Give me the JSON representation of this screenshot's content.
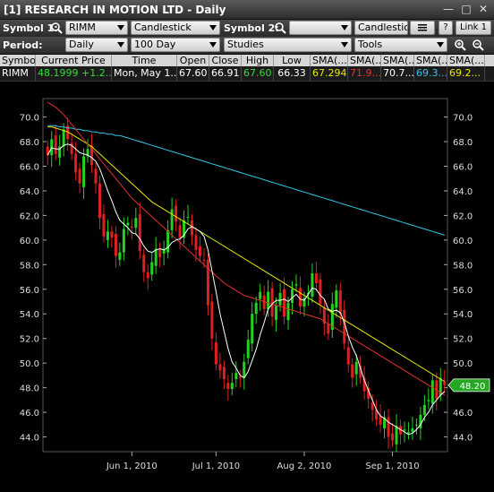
{
  "window": {
    "title": "[1] RESEARCH IN MOTION LTD - Daily"
  },
  "toolbar1": {
    "symbol1_label": "Symbol 1:",
    "symbol1_value": "RIMM",
    "chart_type": "Candlestick",
    "symbol2_label": "Symbol 2:",
    "symbol2_value": "",
    "chart_type2": "Candlestick",
    "help_label": "?",
    "link_label": "Link 1"
  },
  "toolbar2": {
    "period_label": "Period:",
    "period_value": "Daily",
    "range_value": "100 Day",
    "studies_value": "Studies",
    "tools_value": "Tools"
  },
  "quote": {
    "headers": [
      "Symbol",
      "Current Price",
      "Time",
      "Open",
      "Close",
      "High",
      "Low",
      "SMA(...",
      "SMA(...",
      "SMA(...",
      "SMA(...",
      "SMA(..."
    ],
    "values": [
      "RIMM",
      "48.1999 +1.2...",
      "Mon, May 1...",
      "67.60",
      "66.91",
      "67.60",
      "66.33",
      "67.294",
      "71.9...",
      "70.7...",
      "69.3...",
      "69.2..."
    ],
    "colors": [
      "#ffffff",
      "#33dd33",
      "#ffffff",
      "#ffffff",
      "#ffffff",
      "#33dd33",
      "#ffffff",
      "#e8e800",
      "#e23030",
      "#ffffff",
      "#33c8e6",
      "#e8e800"
    ]
  },
  "chart_data": {
    "type": "candlestick",
    "price_axis": {
      "min": 42.8,
      "max": 71.5,
      "ticks": [
        "70.0",
        "68.0",
        "66.0",
        "64.0",
        "62.0",
        "60.0",
        "58.0",
        "56.0",
        "54.0",
        "52.0",
        "50.0",
        "48.0",
        "46.0",
        "44.0"
      ]
    },
    "x_labels": [
      "Jun 1, 2010",
      "Jul 1, 2010",
      "Aug 2, 2010",
      "Sep 1, 2010"
    ],
    "current_price_tag": "48.20",
    "closes": [
      66.9,
      68.2,
      67.0,
      67.6,
      69.0,
      68.2,
      67.0,
      65.5,
      64.6,
      66.8,
      67.4,
      66.1,
      64.6,
      61.8,
      60.3,
      60.7,
      60.2,
      58.7,
      59.0,
      60.9,
      61.4,
      61.0,
      61.8,
      59.1,
      57.4,
      56.9,
      58.2,
      59.3,
      58.6,
      59.3,
      60.8,
      62.5,
      61.5,
      60.2,
      61.6,
      61.9,
      60.4,
      59.2,
      58.7,
      58.4,
      54.7,
      52.0,
      49.9,
      49.4,
      48.7,
      47.9,
      48.4,
      49.2,
      48.8,
      50.1,
      51.9,
      54.0,
      54.9,
      55.8,
      54.4,
      55.8,
      53.8,
      54.7,
      55.7,
      53.8,
      54.9,
      56.0,
      56.4,
      54.6,
      55.3,
      55.7,
      57.3,
      56.5,
      54.8,
      53.2,
      52.4,
      54.8,
      55.9,
      54.0,
      51.6,
      49.9,
      48.8,
      50.1,
      48.8,
      47.7,
      47.1,
      46.2,
      45.4,
      45.0,
      45.6,
      44.0,
      43.7,
      44.9,
      44.2,
      44.6,
      44.4,
      44.7,
      45.0,
      45.8,
      46.6,
      47.0,
      48.6,
      47.1,
      48.8,
      48.2
    ],
    "sma_short": {
      "color": "#ffffff",
      "values": [
        66.9,
        67.5,
        67.4,
        67.4,
        67.7,
        67.8,
        67.7,
        67.4,
        67.1,
        67.0,
        66.9,
        66.7,
        66.4,
        65.8,
        64.9,
        64.0,
        63.2,
        62.3,
        61.6,
        61.3,
        61.0,
        60.6,
        60.5,
        60.1,
        59.5,
        59.1,
        59.0,
        59.2,
        59.3,
        59.2,
        59.4,
        59.8,
        60.0,
        60.1,
        60.4,
        60.9,
        61.1,
        60.9,
        60.7,
        60.3,
        59.2,
        57.5,
        55.8,
        54.0,
        52.6,
        51.2,
        50.1,
        49.6,
        49.0,
        48.8,
        49.3,
        50.2,
        51.1,
        52.3,
        53.3,
        54.4,
        54.8,
        55.1,
        55.1,
        55.2,
        55.0,
        55.3,
        55.6,
        55.2,
        55.1,
        55.6,
        56.1,
        56.0,
        55.5,
        55.2,
        54.4,
        54.2,
        54.3,
        54.1,
        53.3,
        52.2,
        51.3,
        50.6,
        49.6,
        48.6,
        47.8,
        47.0,
        46.2,
        45.7,
        45.5,
        45.2,
        45.0,
        44.8,
        44.6,
        44.4,
        44.2,
        44.3,
        44.6,
        45.0,
        45.6,
        46.0,
        46.6,
        47.0,
        47.4,
        47.7
      ]
    },
    "sma_mid": {
      "color": "#e8e800",
      "values": [
        69.2,
        69.2,
        69.1,
        69.0,
        68.9,
        68.8,
        68.6,
        68.4,
        68.2,
        68.0,
        67.8,
        67.6,
        67.3,
        67.0,
        66.7,
        66.4,
        66.1,
        65.8,
        65.5,
        65.2,
        64.9,
        64.6,
        64.3,
        64.0,
        63.7,
        63.4,
        63.1,
        62.9,
        62.7,
        62.5,
        62.3,
        62.1,
        61.9,
        61.7,
        61.5,
        61.3,
        61.1,
        60.9,
        60.7,
        60.5,
        60.3,
        60.1,
        59.9,
        59.7,
        59.5,
        59.3,
        59.1,
        58.9,
        58.7,
        58.5,
        58.3,
        58.1,
        57.9,
        57.7,
        57.5,
        57.3,
        57.1,
        56.9,
        56.7,
        56.5,
        56.3,
        56.1,
        55.9,
        55.7,
        55.5,
        55.3,
        55.1,
        54.9,
        54.7,
        54.5,
        54.3,
        54.1,
        53.9,
        53.7,
        53.5,
        53.3,
        53.1,
        52.9,
        52.7,
        52.5,
        52.3,
        52.1,
        51.9,
        51.7,
        51.5,
        51.3,
        51.1,
        50.9,
        50.7,
        50.5,
        50.3,
        50.1,
        49.9,
        49.7,
        49.5,
        49.3,
        49.1,
        48.9,
        48.7,
        48.5
      ]
    },
    "sma_red": {
      "color": "#e23030",
      "values": [
        71.2,
        71.0,
        70.8,
        70.5,
        70.2,
        69.8,
        69.4,
        69.0,
        68.6,
        68.2,
        67.8,
        67.4,
        67.0,
        66.6,
        66.2,
        65.8,
        65.4,
        65.0,
        64.6,
        64.2,
        63.8,
        63.4,
        63.1,
        62.8,
        62.5,
        62.2,
        61.9,
        61.6,
        61.3,
        61.0,
        60.7,
        60.4,
        60.1,
        59.8,
        59.5,
        59.2,
        58.9,
        58.6,
        58.3,
        58.0,
        57.7,
        57.4,
        57.1,
        56.8,
        56.5,
        56.3,
        56.1,
        55.9,
        55.7,
        55.5,
        55.4,
        55.3,
        55.2,
        55.1,
        55.0,
        54.9,
        54.8,
        54.7,
        54.6,
        54.5,
        54.4,
        54.3,
        54.2,
        54.1,
        54.0,
        53.9,
        53.8,
        53.7,
        53.6,
        53.4,
        53.2,
        53.0,
        52.8,
        52.6,
        52.4,
        52.2,
        52.0,
        51.8,
        51.6,
        51.4,
        51.2,
        51.0,
        50.8,
        50.6,
        50.4,
        50.2,
        50.0,
        49.8,
        49.6,
        49.4,
        49.2,
        49.0,
        48.8,
        48.6,
        48.4,
        48.2,
        48.0,
        47.8,
        47.6,
        47.4
      ]
    },
    "sma_long": {
      "color": "#33c8e6",
      "values": [
        69.3,
        69.3,
        69.3,
        69.2,
        69.2,
        69.1,
        69.1,
        69.0,
        69.0,
        68.9,
        68.9,
        68.8,
        68.8,
        68.7,
        68.7,
        68.6,
        68.6,
        68.5,
        68.5,
        68.4,
        68.3,
        68.2,
        68.1,
        68.0,
        67.9,
        67.8,
        67.7,
        67.6,
        67.5,
        67.4,
        67.3,
        67.2,
        67.1,
        67.0,
        66.9,
        66.8,
        66.7,
        66.6,
        66.5,
        66.4,
        66.3,
        66.2,
        66.1,
        66.0,
        65.9,
        65.8,
        65.7,
        65.6,
        65.5,
        65.4,
        65.3,
        65.2,
        65.1,
        65.0,
        64.9,
        64.8,
        64.7,
        64.6,
        64.5,
        64.4,
        64.3,
        64.2,
        64.1,
        64.0,
        63.9,
        63.8,
        63.7,
        63.6,
        63.5,
        63.4,
        63.3,
        63.2,
        63.1,
        63.0,
        62.9,
        62.8,
        62.7,
        62.6,
        62.5,
        62.4,
        62.3,
        62.2,
        62.1,
        62.0,
        61.9,
        61.8,
        61.7,
        61.6,
        61.5,
        61.4,
        61.3,
        61.2,
        61.1,
        61.0,
        60.9,
        60.8,
        60.7,
        60.6,
        60.5,
        60.4
      ]
    }
  }
}
